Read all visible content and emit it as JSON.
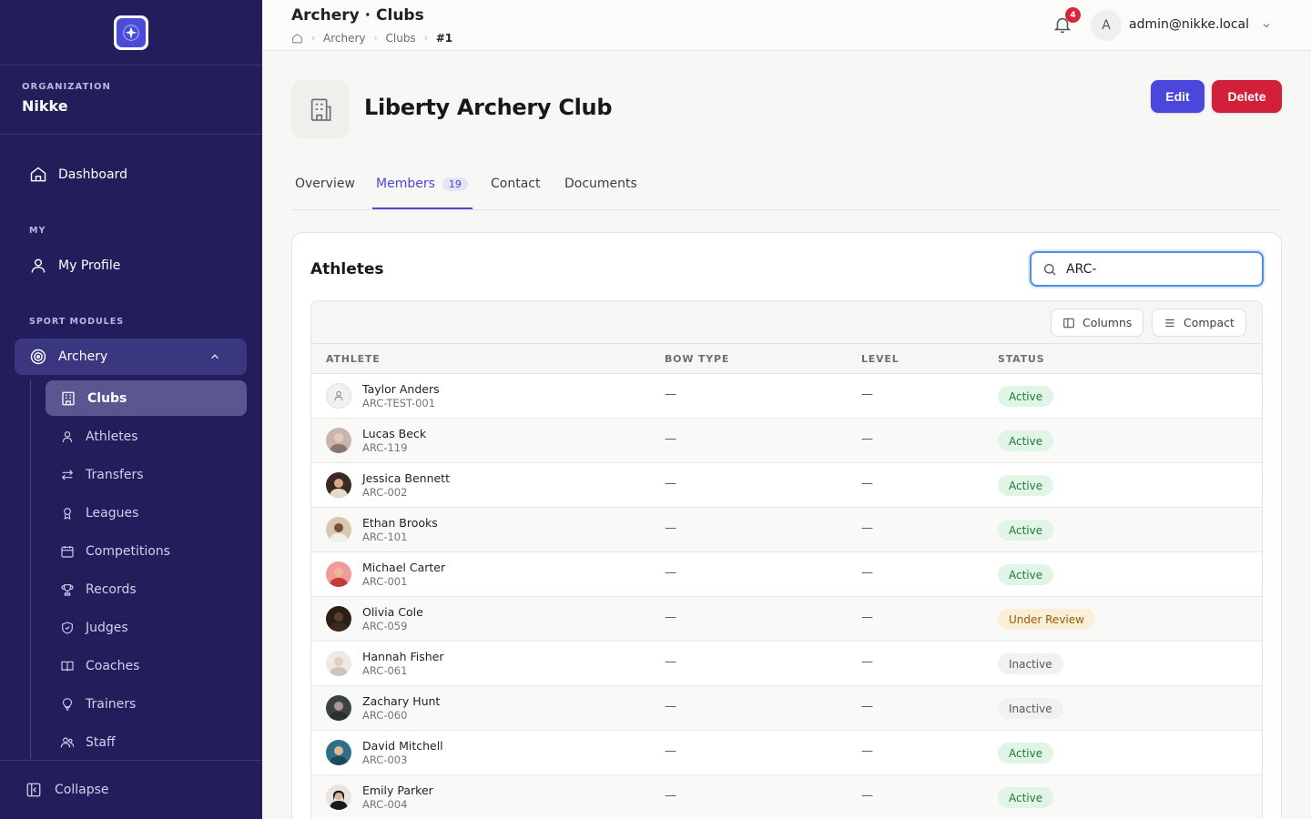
{
  "sidebar": {
    "org_label": "ORGANIZATION",
    "org_name": "Nikke",
    "dashboard": "Dashboard",
    "my_label": "MY",
    "my_profile": "My Profile",
    "sport_label": "SPORT MODULES",
    "archery": "Archery",
    "sub_items": [
      {
        "label": "Clubs",
        "icon": "building-icon",
        "active": true
      },
      {
        "label": "Athletes",
        "icon": "user-icon"
      },
      {
        "label": "Transfers",
        "icon": "transfer-icon"
      },
      {
        "label": "Leagues",
        "icon": "award-icon"
      },
      {
        "label": "Competitions",
        "icon": "calendar-icon"
      },
      {
        "label": "Records",
        "icon": "trophy-icon"
      },
      {
        "label": "Judges",
        "icon": "shield-icon"
      },
      {
        "label": "Coaches",
        "icon": "book-icon"
      },
      {
        "label": "Trainers",
        "icon": "lightbulb-icon"
      },
      {
        "label": "Staff",
        "icon": "users-icon"
      }
    ],
    "collapse": "Collapse"
  },
  "header": {
    "title": "Archery · Clubs",
    "breadcrumb": [
      "Archery",
      "Clubs",
      "#1"
    ],
    "notifications": "4",
    "user_initial": "A",
    "user_email": "admin@nikke.local"
  },
  "club": {
    "name": "Liberty Archery Club",
    "edit": "Edit",
    "delete": "Delete"
  },
  "tabs": [
    {
      "label": "Overview"
    },
    {
      "label": "Members",
      "count": "19",
      "active": true
    },
    {
      "label": "Contact"
    },
    {
      "label": "Documents"
    }
  ],
  "athletes": {
    "title": "Athletes",
    "search_value": "ARC-",
    "columns_btn": "Columns",
    "compact_btn": "Compact",
    "headers": [
      "ATHLETE",
      "BOW TYPE",
      "LEVEL",
      "STATUS"
    ],
    "rows": [
      {
        "name": "Taylor Anders",
        "id": "ARC-TEST-001",
        "bow": "—",
        "level": "—",
        "status": "Active"
      },
      {
        "name": "Lucas Beck",
        "id": "ARC-119",
        "bow": "—",
        "level": "—",
        "status": "Active"
      },
      {
        "name": "Jessica Bennett",
        "id": "ARC-002",
        "bow": "—",
        "level": "—",
        "status": "Active"
      },
      {
        "name": "Ethan Brooks",
        "id": "ARC-101",
        "bow": "—",
        "level": "—",
        "status": "Active"
      },
      {
        "name": "Michael Carter",
        "id": "ARC-001",
        "bow": "—",
        "level": "—",
        "status": "Active"
      },
      {
        "name": "Olivia Cole",
        "id": "ARC-059",
        "bow": "—",
        "level": "—",
        "status": "Under Review"
      },
      {
        "name": "Hannah Fisher",
        "id": "ARC-061",
        "bow": "—",
        "level": "—",
        "status": "Inactive"
      },
      {
        "name": "Zachary Hunt",
        "id": "ARC-060",
        "bow": "—",
        "level": "—",
        "status": "Inactive"
      },
      {
        "name": "David Mitchell",
        "id": "ARC-003",
        "bow": "—",
        "level": "—",
        "status": "Active"
      },
      {
        "name": "Emily Parker",
        "id": "ARC-004",
        "bow": "—",
        "level": "—",
        "status": "Active"
      }
    ]
  },
  "colors": {
    "sidebar_bg": "#221e5b",
    "accent": "#4b46dc",
    "danger": "#d21f3a",
    "active_badge": "#207a3d",
    "review_badge": "#9a5a08"
  }
}
